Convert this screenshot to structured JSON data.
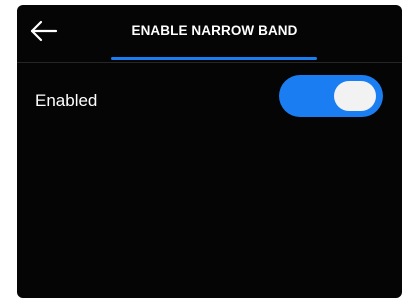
{
  "header": {
    "title": "ENABLE NARROW BAND",
    "back_icon": "arrow-left-icon"
  },
  "setting": {
    "label": "Enabled",
    "toggle_on": true
  },
  "colors": {
    "background": "#050505",
    "accent": "#1a7ef2",
    "text": "#ffffff",
    "knob": "#f2f2f2"
  }
}
